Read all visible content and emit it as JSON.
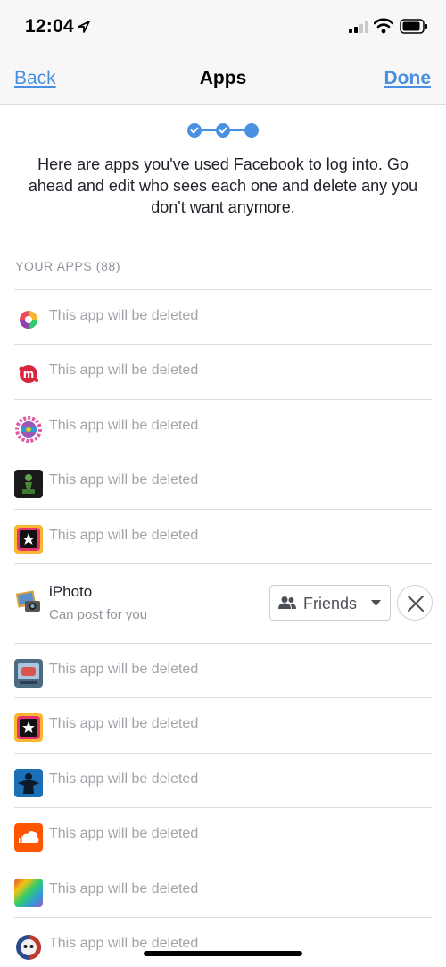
{
  "status_bar": {
    "time": "12:04"
  },
  "nav": {
    "back_label": "Back",
    "title": "Apps",
    "done_label": "Done"
  },
  "intro": {
    "text": "Here are apps you've used Facebook to log into. Go ahead and edit who sees each one and delete any you don't want anymore."
  },
  "progress": {
    "total_steps": 3,
    "completed_steps": 2,
    "current_step": 3
  },
  "section": {
    "header": "YOUR APPS (88)"
  },
  "colors": {
    "accent": "#4a90e2",
    "muted_text": "#90949c",
    "divider": "#dddfe2"
  },
  "apps": [
    {
      "icon": "colorful-swirl-app-icon",
      "status": "This app will be deleted"
    },
    {
      "icon": "red-m-app-icon",
      "status": "This app will be deleted"
    },
    {
      "icon": "sunburst-badge-app-icon",
      "status": "This app will be deleted"
    },
    {
      "icon": "chess-pawn-app-icon",
      "status": "This app will be deleted"
    },
    {
      "icon": "star-app-icon",
      "status": "This app will be deleted"
    },
    {
      "icon": "photo-camera-app-icon",
      "name": "iPhoto",
      "permission": "Can post for you",
      "audience": "Friends",
      "audience_icon": "friends-icon"
    },
    {
      "icon": "screen-app-icon",
      "status": "This app will be deleted"
    },
    {
      "icon": "star-app-icon",
      "status": "This app will be deleted"
    },
    {
      "icon": "silhouette-app-icon",
      "status": "This app will be deleted"
    },
    {
      "icon": "soundcloud-app-icon",
      "status": "This app will be deleted"
    },
    {
      "icon": "rainbow-app-icon",
      "status": "This app will be deleted"
    },
    {
      "icon": "skull-app-icon",
      "status": "This app will be deleted"
    }
  ]
}
